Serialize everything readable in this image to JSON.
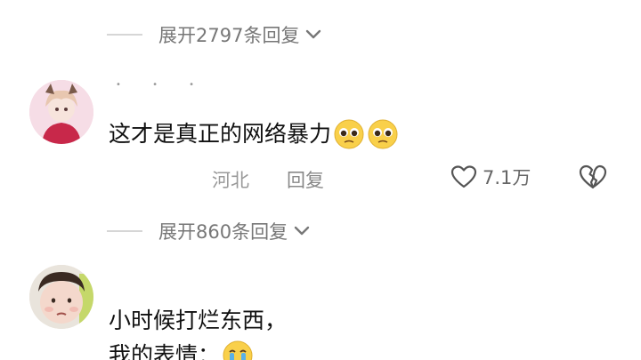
{
  "replies_toggle_1": {
    "label": "展开2797条回复",
    "icon": "chevron-down-icon"
  },
  "comment_1": {
    "text": "这才是真正的网络暴力",
    "emoji": "pleading-face",
    "location": "河北",
    "reply_label": "回复",
    "like_count": "7.1万",
    "like_icon": "heart-outline-icon",
    "dislike_icon": "broken-heart-icon"
  },
  "replies_toggle_2": {
    "label": "展开860条回复",
    "icon": "chevron-down-icon"
  },
  "comment_2": {
    "line1": "小时候打烂东西，",
    "line2": "我的表情："
  },
  "colors": {
    "text_primary": "#111111",
    "text_secondary": "#999999",
    "divider": "#d6d6d6"
  }
}
